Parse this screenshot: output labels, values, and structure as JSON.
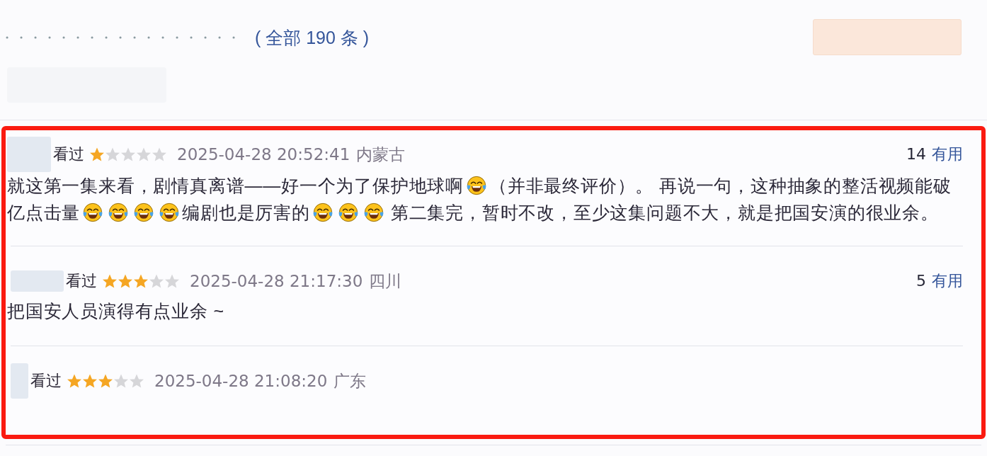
{
  "header": {
    "count_link": "( 全部 190 条 )"
  },
  "reviews": [
    {
      "status": "看过",
      "stars": 1,
      "time": "2025-04-28 20:52:41",
      "location": "内蒙古",
      "votes": "14",
      "votes_label": "有用",
      "lines": [
        [
          {
            "kind": "text",
            "text": "就这第一集来看，剧情真离谱——好一个为了保护地球啊"
          },
          {
            "kind": "emoji"
          },
          {
            "kind": "text",
            "text": "（并非最终评价）。 再说一句，这种抽象的整活视频能破"
          }
        ],
        [
          {
            "kind": "text",
            "text": "亿点击量"
          },
          {
            "kind": "emoji"
          },
          {
            "kind": "emoji"
          },
          {
            "kind": "emoji"
          },
          {
            "kind": "emoji"
          },
          {
            "kind": "text",
            "text": "编剧也是厉害的"
          },
          {
            "kind": "emoji"
          },
          {
            "kind": "emoji"
          },
          {
            "kind": "emoji"
          },
          {
            "kind": "text",
            "text": "第二集完，暂时不改，至少这集问题不大，就是把国安演的很业余。"
          }
        ]
      ]
    },
    {
      "status": "看过",
      "stars": 3,
      "time": "2025-04-28 21:17:30",
      "location": "四川",
      "votes": "5",
      "votes_label": "有用",
      "lines": [
        [
          {
            "kind": "text",
            "text": "把国安人员演得有点业余 ~"
          }
        ]
      ]
    },
    {
      "status": "看过",
      "stars": 3,
      "time": "2025-04-28 21:08:20",
      "location": "广东"
    }
  ]
}
